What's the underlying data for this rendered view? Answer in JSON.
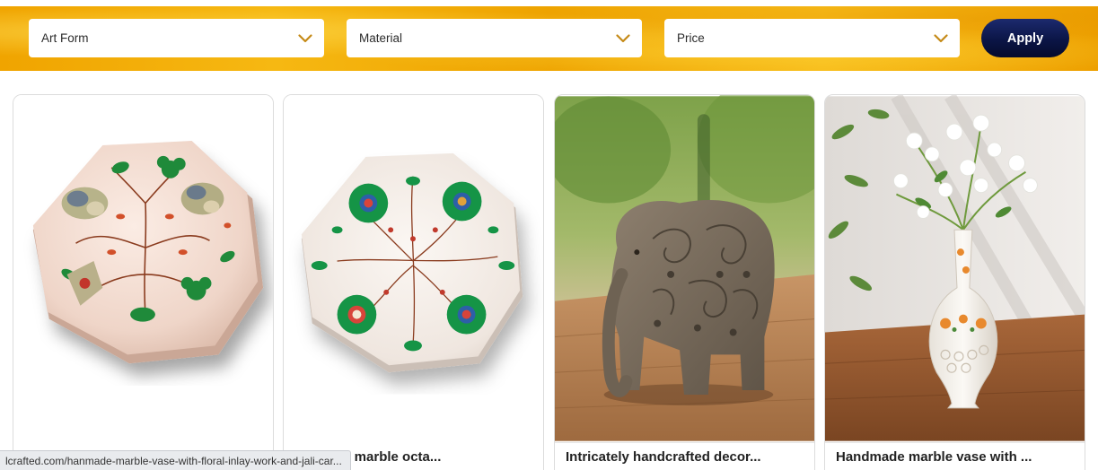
{
  "filters": {
    "art_form": {
      "label": "Art Form"
    },
    "material": {
      "label": "Material"
    },
    "price": {
      "label": "Price"
    },
    "apply_label": "Apply"
  },
  "products": [
    {
      "title": ""
    },
    {
      "title": "ade pure marble octa..."
    },
    {
      "title": "Intricately handcrafted decor..."
    },
    {
      "title": "Handmade marble vase with ..."
    }
  ],
  "status_bar": {
    "url": "lcrafted.com/hanmade-marble-vase-with-floral-inlay-work-and-jali-car..."
  },
  "colors": {
    "filter_bar": "#f2ac08",
    "apply_button": "#0b1546",
    "chevron": "#c58a17"
  }
}
